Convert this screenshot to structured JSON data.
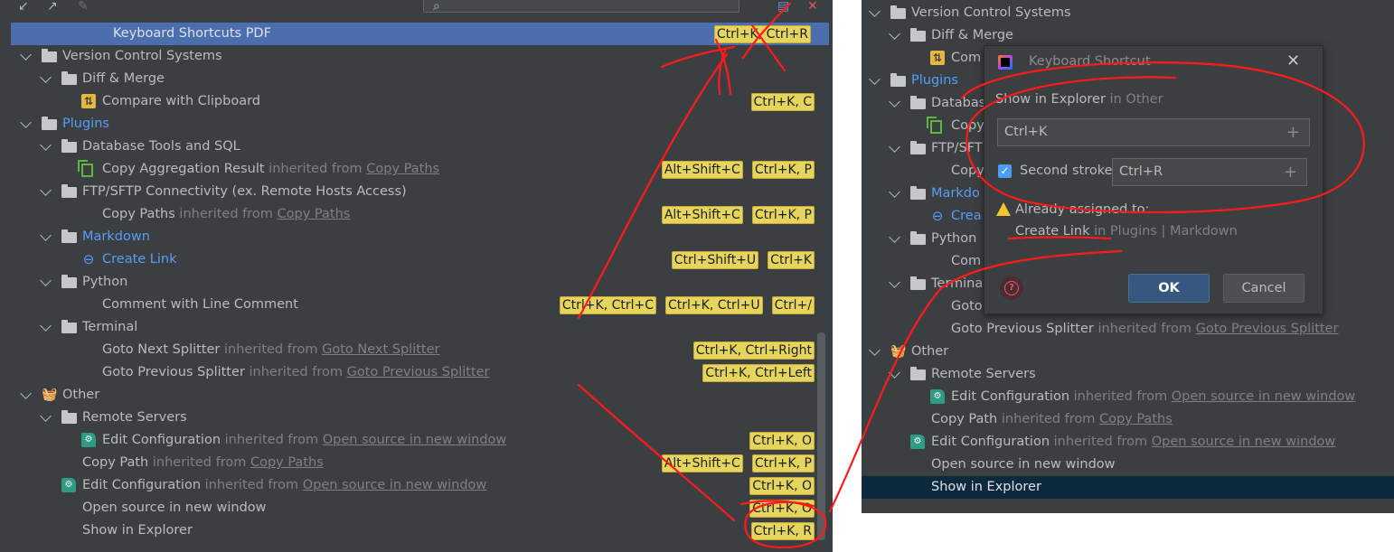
{
  "left_panel": {
    "search": {
      "placeholder": ""
    },
    "rows": [
      {
        "indent": 2,
        "icon": "none",
        "label": "Keyboard Shortcuts PDF",
        "selected": true,
        "shortcuts": [
          "Ctrl+K, Ctrl+R"
        ]
      },
      {
        "indent": 0,
        "icon": "folder",
        "label": "Version Control Systems",
        "expand": true,
        "shortcuts": []
      },
      {
        "indent": 1,
        "icon": "folder",
        "label": "Diff & Merge",
        "expand": true,
        "shortcuts": []
      },
      {
        "indent": 2,
        "icon": "diff-icon",
        "label": "Compare with Clipboard",
        "shortcuts": [
          "Ctrl+K, C"
        ]
      },
      {
        "indent": 0,
        "icon": "folder",
        "label": "Plugins",
        "expand": true,
        "blue": true,
        "shortcuts": []
      },
      {
        "indent": 1,
        "icon": "folder",
        "label": "Database Tools and SQL",
        "expand": true,
        "shortcuts": []
      },
      {
        "indent": 2,
        "icon": "copy-icon",
        "label": "Copy Aggregation Result",
        "inherit": " inherited from ",
        "inherit_link": "Copy Paths",
        "shortcuts": [
          "Alt+Shift+C",
          "Ctrl+K, P"
        ]
      },
      {
        "indent": 1,
        "icon": "folder",
        "label": "FTP/SFTP Connectivity (ex. Remote Hosts Access)",
        "expand": true,
        "shortcuts": []
      },
      {
        "indent": 2,
        "icon": "none",
        "label": "Copy Paths",
        "inherit": " inherited from ",
        "inherit_link": "Copy Paths",
        "shortcuts": [
          "Alt+Shift+C",
          "Ctrl+K, P"
        ]
      },
      {
        "indent": 1,
        "icon": "folder",
        "label": "Markdown",
        "expand": true,
        "blue": true,
        "shortcuts": []
      },
      {
        "indent": 2,
        "icon": "link-icon",
        "label": "Create Link",
        "blue": true,
        "shortcuts": [
          "Ctrl+Shift+U",
          "Ctrl+K"
        ]
      },
      {
        "indent": 1,
        "icon": "folder",
        "label": "Python",
        "expand": true,
        "shortcuts": []
      },
      {
        "indent": 2,
        "icon": "none",
        "label": "Comment with Line Comment",
        "shortcuts": [
          "Ctrl+K, Ctrl+C",
          "Ctrl+K, Ctrl+U",
          "Ctrl+/"
        ]
      },
      {
        "indent": 1,
        "icon": "folder",
        "label": "Terminal",
        "expand": true,
        "shortcuts": []
      },
      {
        "indent": 2,
        "icon": "none",
        "label": "Goto Next Splitter",
        "inherit": " inherited from ",
        "inherit_link": "Goto Next Splitter",
        "shortcuts": [
          "Ctrl+K, Ctrl+Right"
        ]
      },
      {
        "indent": 2,
        "icon": "none",
        "label": "Goto Previous Splitter",
        "inherit": " inherited from ",
        "inherit_link": "Goto Previous Splitter",
        "shortcuts": [
          "Ctrl+K, Ctrl+Left"
        ]
      },
      {
        "indent": 0,
        "icon": "basket-icon",
        "label": "Other",
        "expand": true,
        "shortcuts": []
      },
      {
        "indent": 1,
        "icon": "folder",
        "label": "Remote Servers",
        "expand": true,
        "shortcuts": []
      },
      {
        "indent": 2,
        "icon": "config-icon",
        "label": "Edit Configuration",
        "inherit": " inherited from ",
        "inherit_link": "Open source in new window",
        "shortcuts": [
          "Ctrl+K, O"
        ]
      },
      {
        "indent": 1,
        "icon": "none",
        "label": "Copy Path",
        "inherit": " inherited from ",
        "inherit_link": "Copy Paths",
        "shortcuts": [
          "Alt+Shift+C",
          "Ctrl+K, P"
        ]
      },
      {
        "indent": 1,
        "icon": "config-icon",
        "label": "Edit Configuration",
        "inherit": " inherited from ",
        "inherit_link": "Open source in new window",
        "shortcuts": [
          "Ctrl+K, O"
        ]
      },
      {
        "indent": 1,
        "icon": "none",
        "label": "Open source in new window",
        "shortcuts": [
          "Ctrl+K, O"
        ]
      },
      {
        "indent": 1,
        "icon": "none",
        "label": "Show in Explorer",
        "shortcuts": [
          "Ctrl+K, R"
        ]
      }
    ]
  },
  "right_panel": {
    "rows": [
      {
        "indent": 0,
        "icon": "folder",
        "label": "Version Control Systems",
        "expand": true
      },
      {
        "indent": 1,
        "icon": "folder",
        "label": "Diff & Merge",
        "expand": true
      },
      {
        "indent": 2,
        "icon": "diff-icon",
        "label": "Com"
      },
      {
        "indent": 0,
        "icon": "folder",
        "label": "Plugins",
        "expand": true,
        "blue": true
      },
      {
        "indent": 1,
        "icon": "folder",
        "label": "Databas",
        "expand": true
      },
      {
        "indent": 2,
        "icon": "copy-icon",
        "label": "Copy"
      },
      {
        "indent": 1,
        "icon": "folder",
        "label": "FTP/SFT",
        "expand": true
      },
      {
        "indent": 2,
        "icon": "none",
        "label": "Copy"
      },
      {
        "indent": 1,
        "icon": "folder",
        "label": "Markdo",
        "expand": true,
        "blue": true
      },
      {
        "indent": 2,
        "icon": "link-icon",
        "label": "Crea",
        "blue": true
      },
      {
        "indent": 1,
        "icon": "folder",
        "label": "Python",
        "expand": true
      },
      {
        "indent": 2,
        "icon": "none",
        "label": "Com"
      },
      {
        "indent": 1,
        "icon": "folder",
        "label": "Termina",
        "expand": true
      },
      {
        "indent": 2,
        "icon": "none",
        "label": "Goto"
      },
      {
        "indent": 2,
        "icon": "none",
        "label": "Goto Previous Splitter",
        "inherit": " inherited from ",
        "inherit_link": "Goto Previous Splitter"
      },
      {
        "indent": 0,
        "icon": "basket-icon",
        "label": "Other",
        "expand": true
      },
      {
        "indent": 1,
        "icon": "folder",
        "label": "Remote Servers",
        "expand": true
      },
      {
        "indent": 2,
        "icon": "config-icon",
        "label": "Edit Configuration",
        "inherit": " inherited from ",
        "inherit_link": "Open source in new window"
      },
      {
        "indent": 1,
        "icon": "none",
        "label": "Copy Path",
        "inherit": " inherited from ",
        "inherit_link": "Copy Paths"
      },
      {
        "indent": 1,
        "icon": "config-icon",
        "label": "Edit Configuration",
        "inherit": " inherited from ",
        "inherit_link": "Open source in new window"
      },
      {
        "indent": 1,
        "icon": "none",
        "label": "Open source in new window"
      },
      {
        "indent": 1,
        "icon": "none",
        "label": "Show in Explorer",
        "selected": true
      }
    ]
  },
  "dialog": {
    "title": "Keyboard Shortcut",
    "action": "Show in Explorer",
    "action_in": " in Other",
    "first_stroke": "Ctrl+K",
    "second_stroke_checked": true,
    "second_stroke_label": "Second stroke:",
    "second_stroke": "Ctrl+R",
    "warning": "Already assigned to:",
    "conflict_action": "Create Link",
    "conflict_in": " in Plugins | Markdown",
    "ok_label": "OK",
    "cancel_label": "Cancel"
  },
  "colors": {
    "panel_bg": "#3c3f41",
    "selection_blue": "#4b6eaf",
    "selection_dark": "#0d293e",
    "shortcut_badge": "#e5d55c",
    "annotation_red": "#ff0000"
  }
}
